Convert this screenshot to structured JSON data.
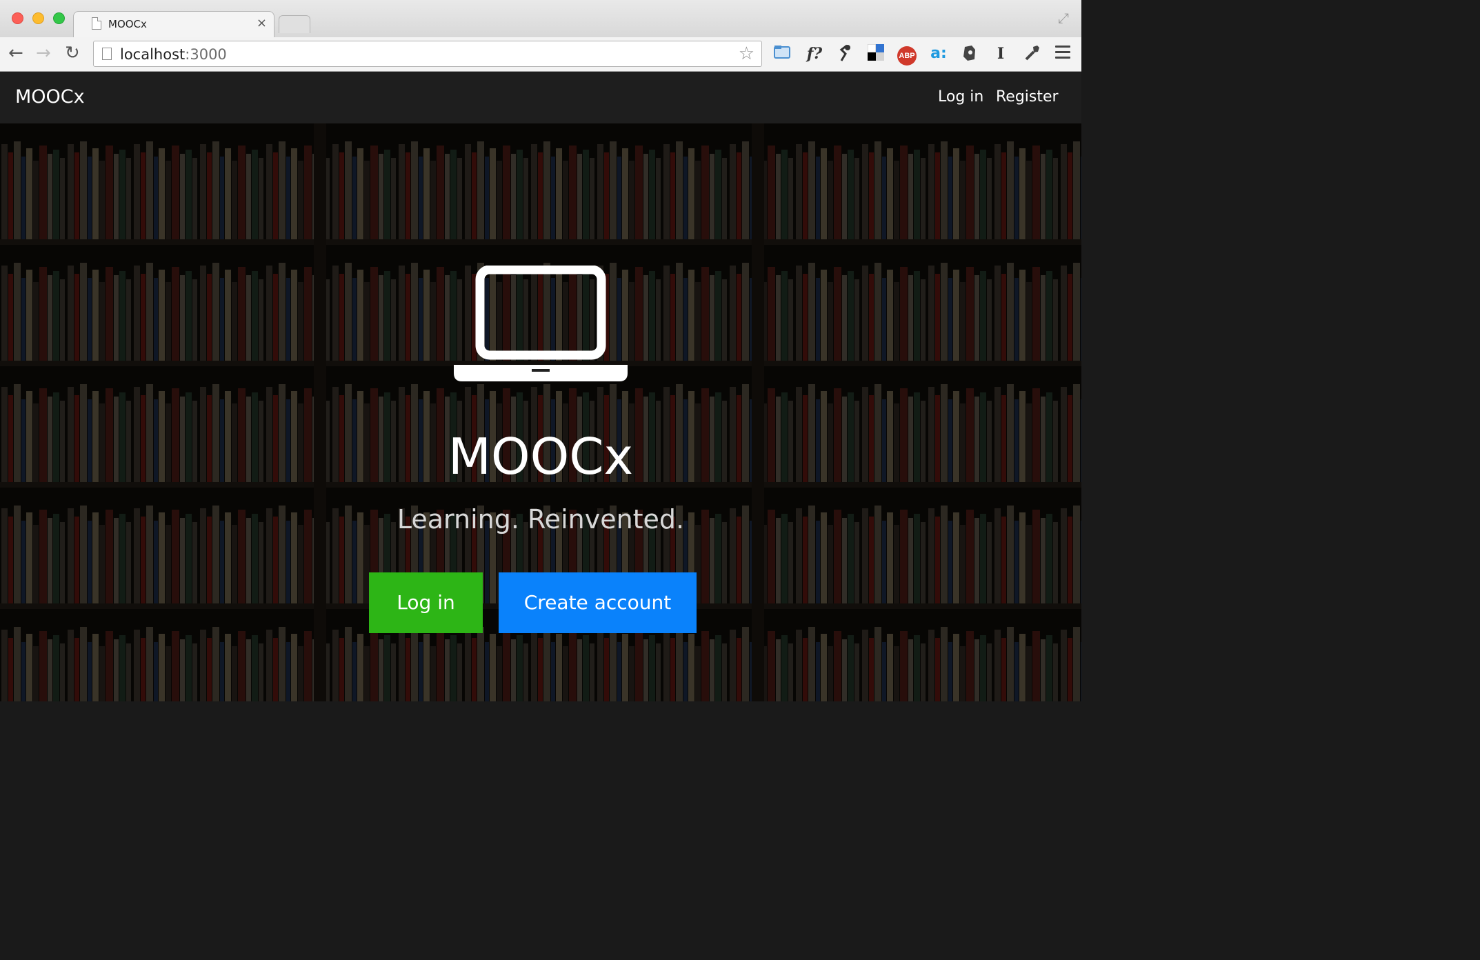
{
  "browser": {
    "tab_title": "MOOCx",
    "tab_close": "×",
    "url_host": "localhost",
    "url_port": ":3000",
    "extensions": {
      "formula": "f?",
      "abp": "ABP",
      "amazon": "a:",
      "instapaper": "I"
    },
    "icons": [
      "back-arrow-icon",
      "forward-arrow-icon",
      "reload-icon",
      "bookmark-star-icon",
      "cast-icon",
      "lamp-icon",
      "delicious-icon",
      "adblock-icon",
      "amazon-icon",
      "evernote-icon",
      "instapaper-icon",
      "wrench-icon",
      "menu-icon"
    ]
  },
  "navbar": {
    "brand": "MOOCx",
    "login": "Log in",
    "register": "Register"
  },
  "hero": {
    "title": "MOOCx",
    "tagline": "Learning. Reinvented.",
    "login_button": "Log in",
    "create_button": "Create account"
  },
  "colors": {
    "navbar_bg": "#1e1e1e",
    "login_green": "#2db516",
    "create_blue": "#0a82fb"
  }
}
